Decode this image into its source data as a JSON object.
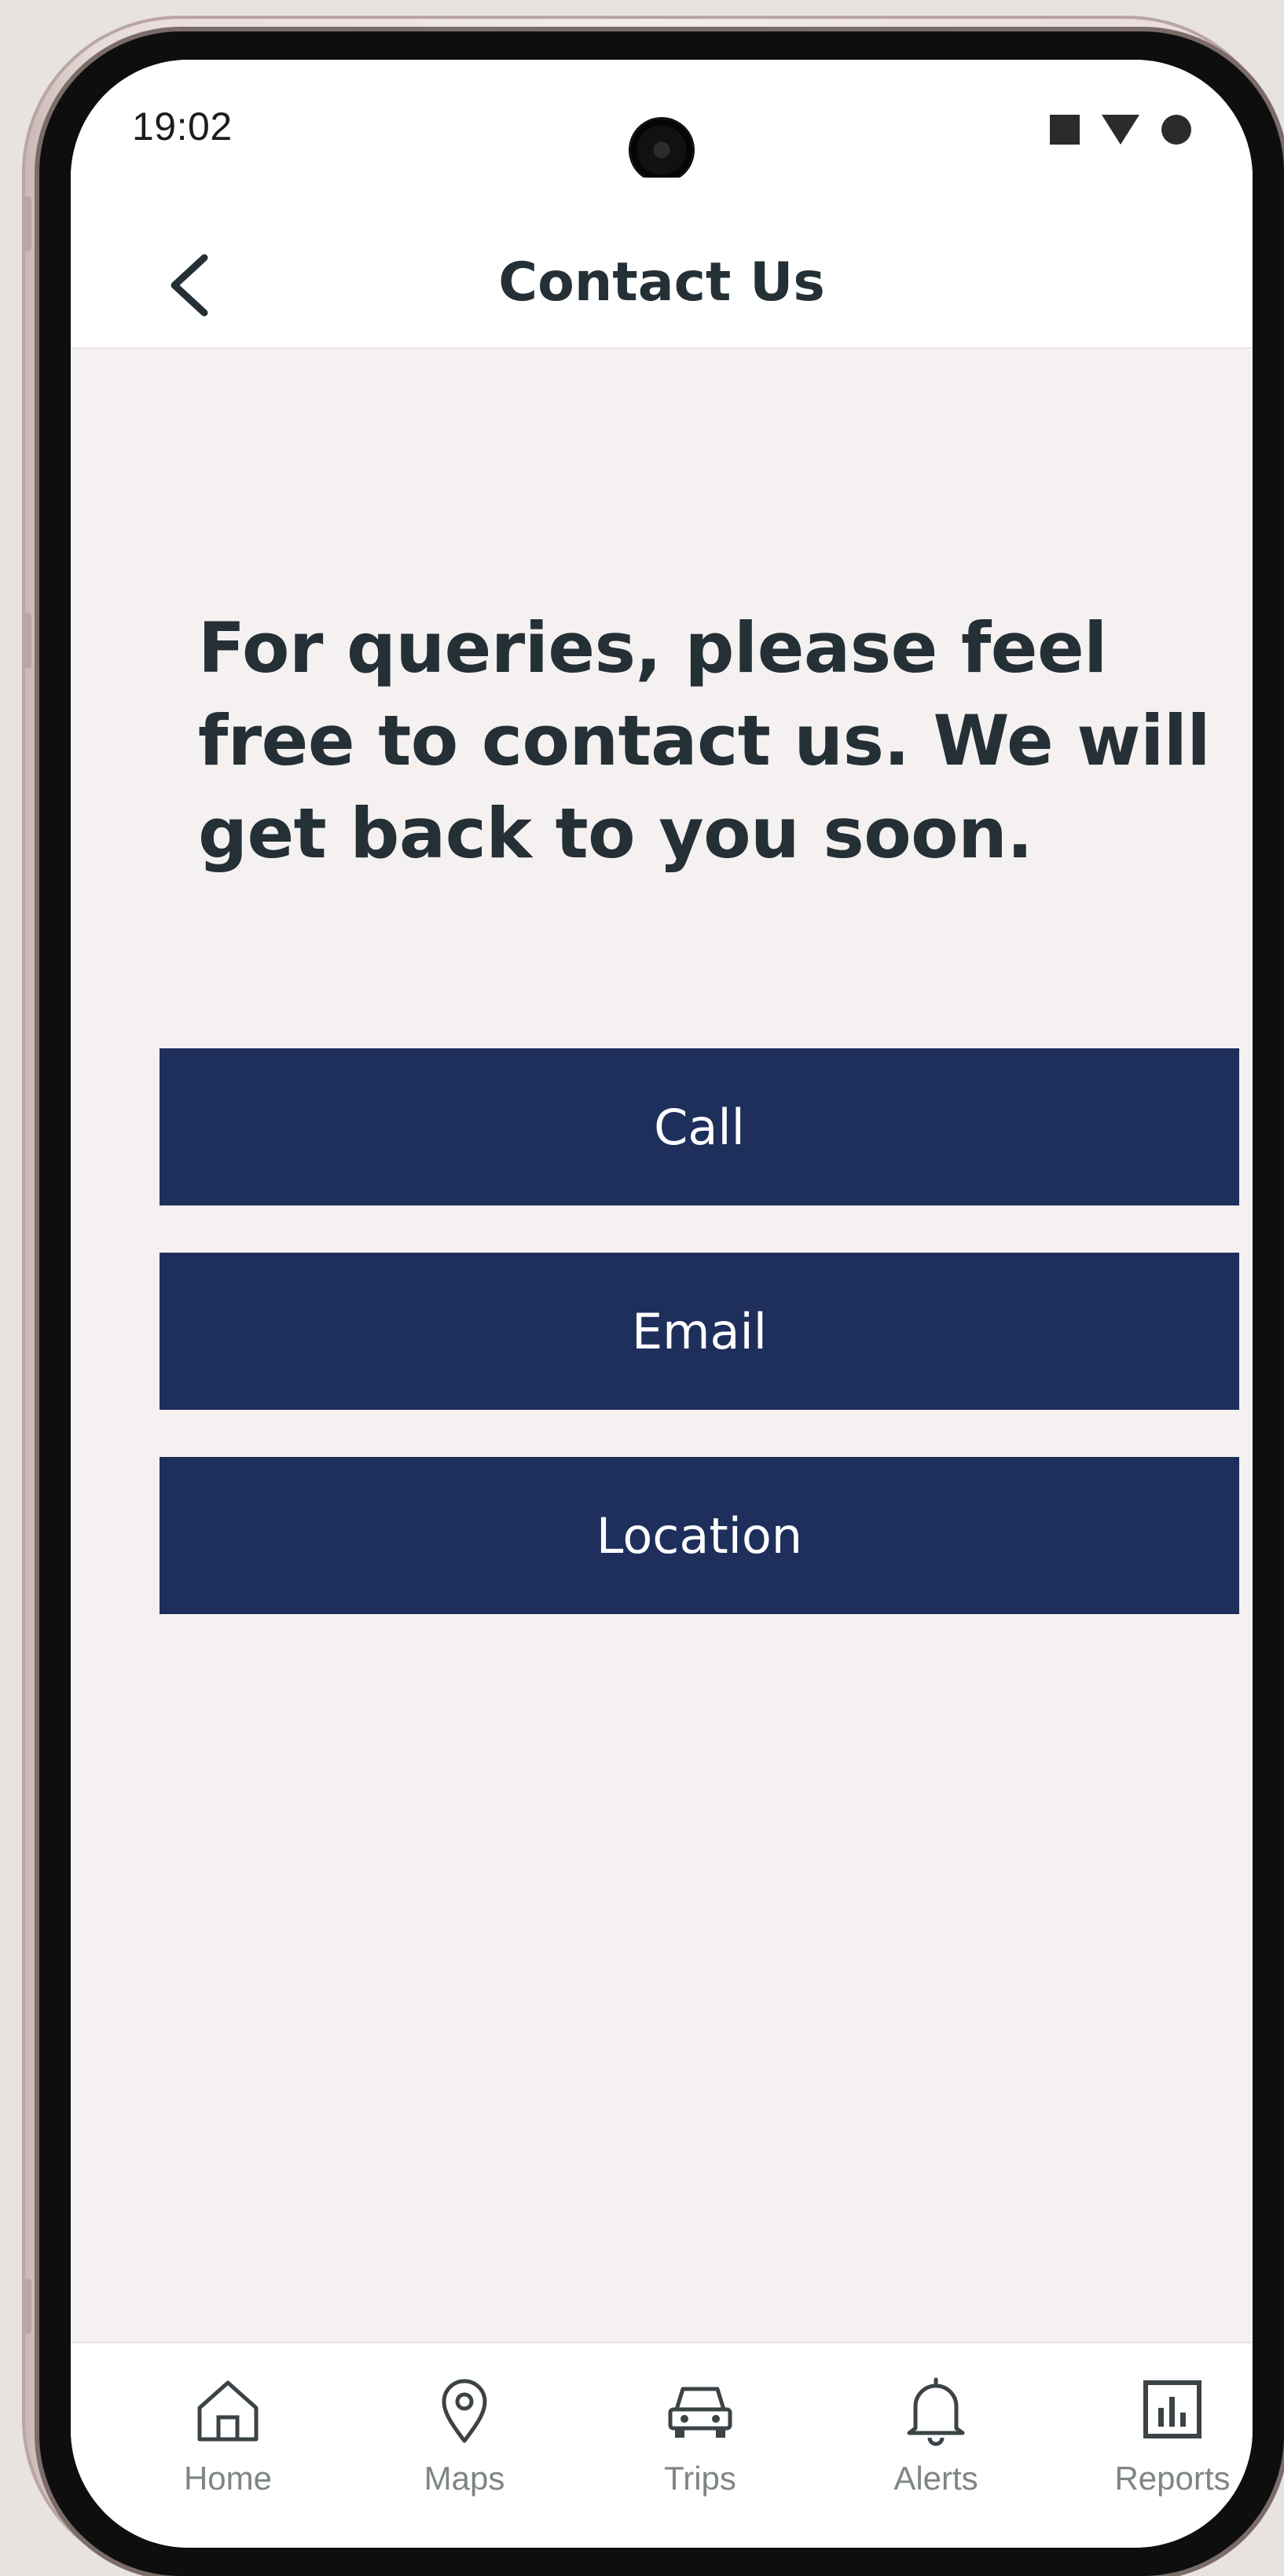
{
  "status_bar": {
    "time": "19:02"
  },
  "header": {
    "back_icon": "chevron-left-icon",
    "title": "Contact Us"
  },
  "content": {
    "intro_text": "For queries, please feel free to contact us. We will get back to you soon.",
    "buttons": [
      {
        "label": "Call"
      },
      {
        "label": "Email"
      },
      {
        "label": "Location"
      }
    ]
  },
  "bottom_nav": {
    "items": [
      {
        "label": "Home",
        "icon": "home-icon"
      },
      {
        "label": "Maps",
        "icon": "map-pin-icon"
      },
      {
        "label": "Trips",
        "icon": "car-icon"
      },
      {
        "label": "Alerts",
        "icon": "bell-icon"
      },
      {
        "label": "Reports",
        "icon": "bar-chart-icon"
      }
    ]
  },
  "colors": {
    "primary_button": "#1f2f5c",
    "text_dark": "#243036",
    "background": "#f5f1f0",
    "nav_inactive": "#7f8586"
  }
}
